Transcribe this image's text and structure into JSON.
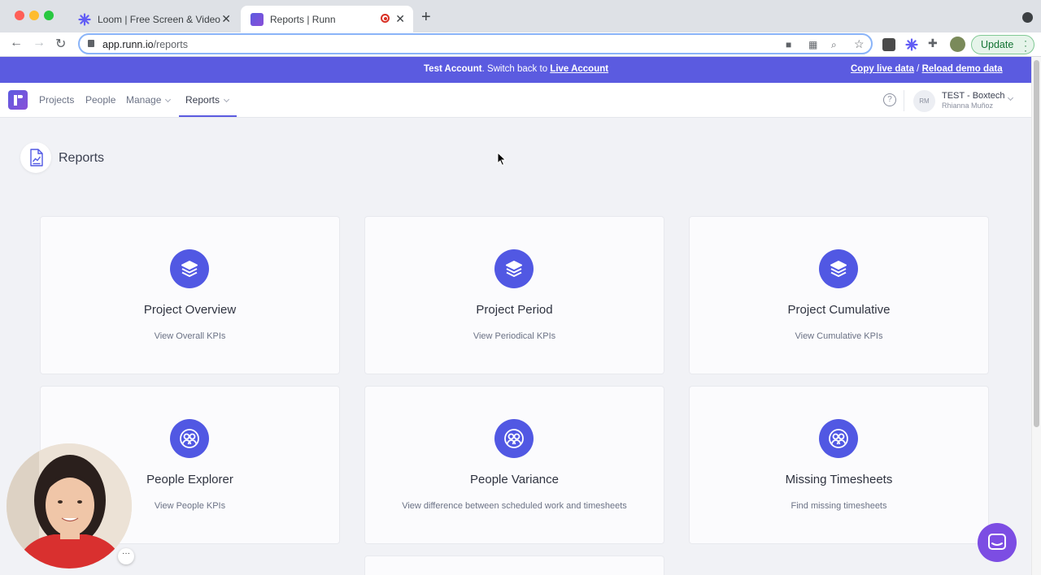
{
  "browser": {
    "tabs": [
      {
        "title": "Loom | Free Screen & Video Re",
        "active": false
      },
      {
        "title": "Reports | Runn",
        "active": true
      }
    ],
    "address": {
      "host": "app.runn.io",
      "path": "/reports"
    },
    "update_label": "Update"
  },
  "banner": {
    "bold": "Test Account",
    "text": ". Switch back to ",
    "link": "Live Account",
    "copy": "Copy live data",
    "sep": "/",
    "reload": "Reload demo data"
  },
  "nav": {
    "items": [
      {
        "label": "Projects"
      },
      {
        "label": "People"
      },
      {
        "label": "Manage"
      },
      {
        "label": "Reports"
      }
    ],
    "help": "?",
    "account": {
      "initials": "RM",
      "name": "TEST - Boxtech",
      "user": "Rhianna Muñoz"
    }
  },
  "page": {
    "title": "Reports"
  },
  "cards": [
    {
      "title": "Project Overview",
      "subtitle": "View Overall KPIs",
      "icon": "layers-icon"
    },
    {
      "title": "Project Period",
      "subtitle": "View Periodical KPIs",
      "icon": "layers-icon"
    },
    {
      "title": "Project Cumulative",
      "subtitle": "View Cumulative KPIs",
      "icon": "layers-icon"
    },
    {
      "title": "People Explorer",
      "subtitle": "View People KPIs",
      "icon": "people-icon"
    },
    {
      "title": "People Variance",
      "subtitle": "View difference between scheduled work and timesheets",
      "icon": "people-icon"
    },
    {
      "title": "Missing Timesheets",
      "subtitle": "Find missing timesheets",
      "icon": "people-icon"
    }
  ],
  "loom": {
    "more": "···"
  },
  "colors": {
    "accent": "#5b5be0",
    "icon_bg": "#5158e3",
    "chat": "#7c4de3"
  }
}
